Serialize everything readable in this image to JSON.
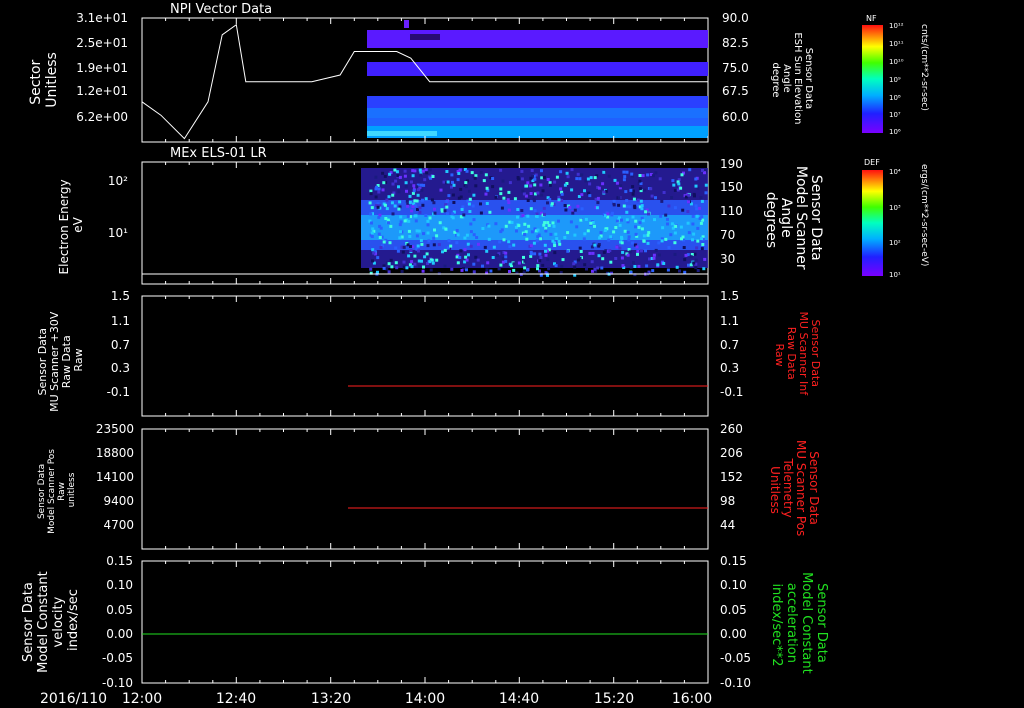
{
  "date_label": "2016/110",
  "time_ticks": [
    "12:00",
    "12:40",
    "13:20",
    "14:00",
    "14:40",
    "15:20",
    "16:00"
  ],
  "panels": [
    {
      "title": "NPI Vector Data",
      "left_label": [
        "Sector",
        "Unitless"
      ],
      "left_ticks": [
        "3.1e+01",
        "2.5e+01",
        "1.9e+01",
        "1.2e+01",
        "6.2e+00"
      ],
      "right_label": [
        "Sensor Data",
        "ESH Sun Elevation",
        "Angle",
        "degree"
      ],
      "right_ticks": [
        "90.0",
        "82.5",
        "75.0",
        "67.5",
        "60.0"
      ],
      "colorbar": {
        "label": "NF",
        "ticks": [
          "10¹²",
          "10¹¹",
          "10¹⁰",
          "10⁹",
          "10⁸",
          "10⁷",
          "10⁶"
        ],
        "unit": "cnts/(cm**2-sr-sec)"
      }
    },
    {
      "title": "MEx ELS-01 LR",
      "left_label": [
        "Electron Energy",
        "eV"
      ],
      "left_ticks": [
        "10²",
        "10¹"
      ],
      "right_label": [
        "Sensor Data",
        "Model Scanner",
        "Angle",
        "degrees"
      ],
      "right_ticks": [
        "190",
        "150",
        "110",
        "70",
        "30"
      ],
      "colorbar": {
        "label": "DEF",
        "ticks": [
          "10⁴",
          "10³",
          "10²",
          "10¹"
        ],
        "unit": "ergs/(cm**2-sr-sec-eV)"
      }
    },
    {
      "left_label": [
        "Sensor Data",
        "MU Scanner +30V",
        "Raw Data",
        "Raw"
      ],
      "left_ticks": [
        "1.5",
        "1.1",
        "0.7",
        "0.3",
        "-0.1"
      ],
      "right_label": [
        "Sensor Data",
        "MU Scanner Inf",
        "Raw Data",
        "Raw"
      ],
      "right_ticks": [
        "1.5",
        "1.1",
        "0.7",
        "0.3",
        "-0.1"
      ]
    },
    {
      "left_label": [
        "Sensor Data",
        "Model Scanner Pos",
        "Raw",
        "unitless"
      ],
      "left_ticks": [
        "23500",
        "18800",
        "14100",
        "9400",
        "4700"
      ],
      "right_label": [
        "Sensor Data",
        "MU Scanner Pos",
        "Telemetry",
        "Unitless"
      ],
      "right_ticks": [
        "260",
        "206",
        "152",
        "98",
        "44"
      ]
    },
    {
      "left_label": [
        "Sensor Data",
        "Model Constant",
        "velocity",
        "index/sec"
      ],
      "left_ticks": [
        "0.15",
        "0.10",
        "0.05",
        "0.00",
        "-0.05",
        "-0.10"
      ],
      "right_label": [
        "Sensor Data",
        "Model Constant",
        "acceleration",
        "index/sec**2"
      ],
      "right_ticks": [
        "0.15",
        "0.10",
        "0.05",
        "0.00",
        "-0.05",
        "-0.10"
      ]
    }
  ],
  "colors": {
    "axis": "#ffffff",
    "red_trace": "#ff2020",
    "green_trace": "#20e020",
    "spectrogram": "#3030ff"
  },
  "chart_data": [
    {
      "type": "heatmap",
      "title": "NPI Vector Data",
      "x_range": [
        "12:00",
        "16:00"
      ],
      "ylabel": "Sector Unitless",
      "y_ticks": [
        6.2,
        12,
        19,
        25,
        31
      ],
      "data_start": "13:36",
      "overlay_line": {
        "y2label": "Sensor Data ESH Sun Elevation Angle degree",
        "y2_range": [
          55,
          92
        ],
        "x": [
          "12:00",
          "12:08",
          "12:18",
          "12:28",
          "12:34",
          "12:40",
          "12:44",
          "12:48",
          "13:00",
          "13:12",
          "13:24",
          "13:30",
          "13:40",
          "13:48",
          "13:54",
          "14:02",
          "14:06",
          "16:00"
        ],
        "y": [
          67,
          63,
          56,
          67,
          87,
          90,
          73,
          73,
          73,
          73,
          75,
          82,
          82,
          82,
          80,
          73,
          73,
          73
        ]
      }
    },
    {
      "type": "heatmap",
      "title": "MEx ELS-01 LR",
      "x_range": [
        "12:00",
        "16:00"
      ],
      "ylabel": "Electron Energy eV",
      "ylog": true,
      "data_start": "13:36",
      "overlay_line": {
        "y2label": "Sensor Data Model Scanner Angle degrees",
        "y2_range": [
          10,
          190
        ],
        "x": [
          "12:00",
          "16:00"
        ],
        "y": [
          11,
          11
        ]
      }
    },
    {
      "type": "line",
      "ylabel": "Sensor Data MU Scanner +30V Raw Data Raw",
      "ylim": [
        -0.3,
        1.5
      ],
      "series": [
        {
          "name": "Sensor Data MU Scanner Inf Raw Data Raw",
          "x": [
            "13:28",
            "16:00"
          ],
          "y": [
            0.0,
            0.0
          ]
        }
      ]
    },
    {
      "type": "line",
      "ylabel": "Sensor Data Model Scanner Pos Raw unitless",
      "ylim": [
        0,
        23500
      ],
      "series": [
        {
          "name": "Sensor Data MU Scanner Pos Telemetry Unitless",
          "x": [
            "13:28",
            "16:00"
          ],
          "y": [
            103,
            103
          ]
        }
      ]
    },
    {
      "type": "line",
      "ylabel": "Sensor Data Model Constant velocity index/sec",
      "ylim": [
        -0.1,
        0.15
      ],
      "series": [
        {
          "name": "Sensor Data Model Constant velocity index/sec",
          "x": [
            "12:00",
            "16:00"
          ],
          "y": [
            0.0,
            0.0
          ]
        }
      ]
    }
  ]
}
